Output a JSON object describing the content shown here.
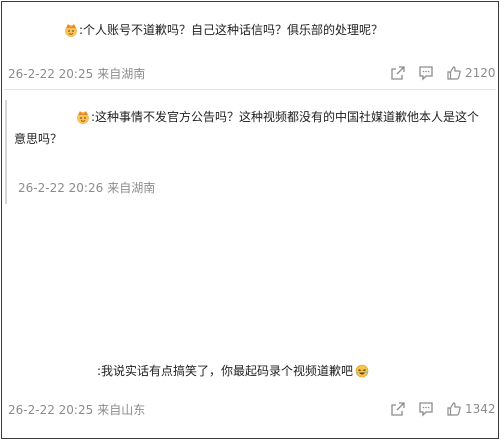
{
  "comments": [
    {
      "text": ":个人账号不道歉吗？自己这种话信吗？俱乐部的处理呢？",
      "date": "26-2-22 20:25",
      "location": "来自湖南",
      "likes": "2120"
    },
    {
      "text": ":这种事情不发官方公告吗？这种视频都没有的中国社媒道歉他本人是这个意思吗？",
      "date": "26-2-22 20:26",
      "location": "来自湖南"
    },
    {
      "text": ":我说实话有点搞笑了，你最起码录个视频道歉吧",
      "date": "26-2-22 20:25",
      "location": "来自山东",
      "likes": "1342"
    }
  ],
  "icons": {
    "avatar": "crown-avatar-icon",
    "emoji": "laughing-emoji-icon",
    "share": "share-icon",
    "comment": "comment-icon",
    "like": "thumbs-up-icon"
  },
  "colors": {
    "meta_gray": "#8c8c8c",
    "avatar_gold": "#f2a93b",
    "emoji_yellow": "#f5c646"
  }
}
